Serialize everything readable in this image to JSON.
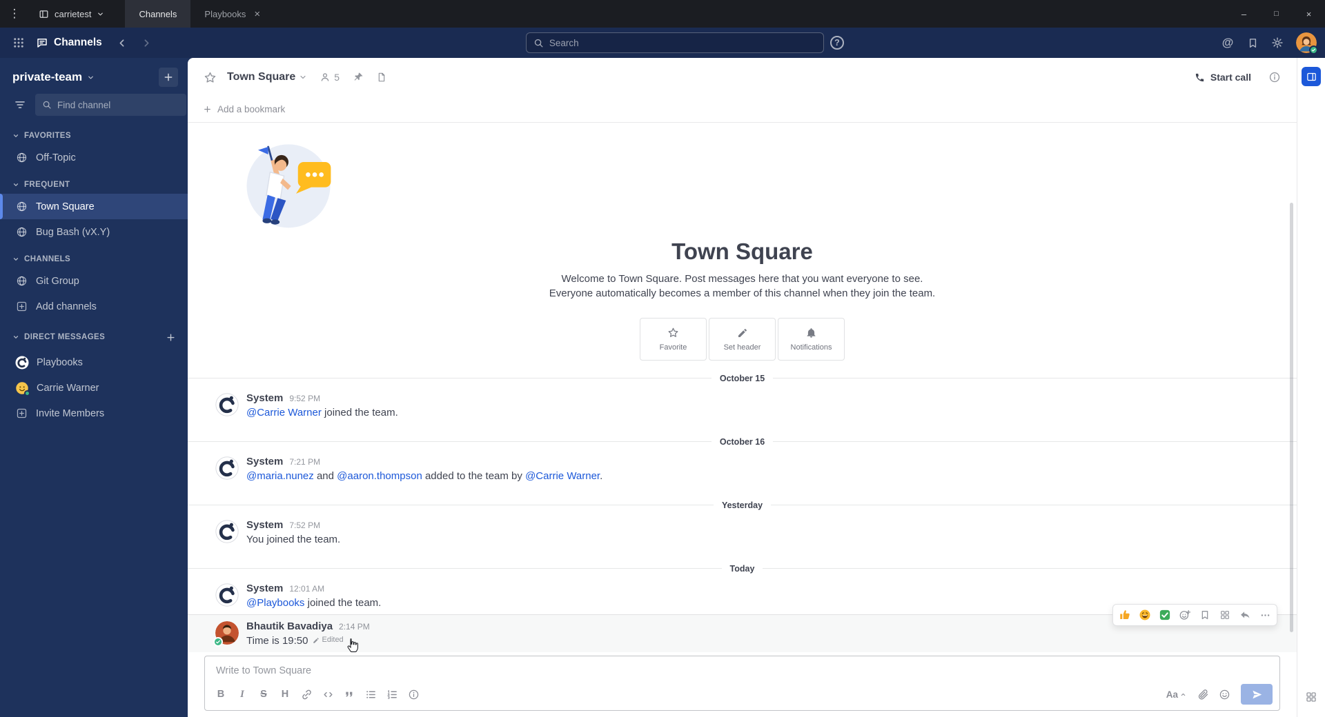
{
  "glyphs": {
    "menu": "⋮",
    "close": "×",
    "at": "@",
    "help": "?"
  },
  "window_bar": {
    "server_name": "carrietest",
    "tabs": [
      {
        "label": "Channels"
      },
      {
        "label": "Playbooks"
      }
    ],
    "controls": {
      "minimize": "–",
      "maximize": "□",
      "close": "×"
    }
  },
  "global_header": {
    "product_name": "Channels",
    "search_placeholder": "Search"
  },
  "sidebar": {
    "team_name": "private-team",
    "find_channel_placeholder": "Find channel",
    "sections": {
      "favorites": "FAVORITES",
      "frequent": "FREQUENT",
      "channels": "CHANNELS",
      "direct_messages": "DIRECT MESSAGES"
    },
    "items": {
      "off_topic": "Off-Topic",
      "town_square": "Town Square",
      "bug_bash": "Bug Bash (vX.Y)",
      "git_group": "Git Group",
      "add_channels": "Add channels",
      "playbooks": "Playbooks",
      "carrie_warner": "Carrie Warner",
      "invite_members": "Invite Members"
    }
  },
  "channel_header": {
    "name": "Town Square",
    "member_count": "5",
    "start_call": "Start call",
    "add_bookmark": "Add a bookmark"
  },
  "intro": {
    "title": "Town Square",
    "description": "Welcome to Town Square. Post messages here that you want everyone to see. Everyone automatically becomes a member of this channel when they join the team.",
    "actions": {
      "favorite": "Favorite",
      "set_header": "Set header",
      "notifications": "Notifications"
    }
  },
  "timeline": {
    "dividers": {
      "d1": "October 15",
      "d2": "October 16",
      "d3": "Yesterday",
      "d4": "Today"
    },
    "messages": {
      "m1": {
        "user": "System",
        "time": "9:52 PM",
        "mention1": "@Carrie Warner",
        "text1": " joined the team."
      },
      "m2": {
        "user": "System",
        "time": "7:21 PM",
        "mention1": "@maria.nunez",
        "text1": " and ",
        "mention2": "@aaron.thompson",
        "text2": " added to the team by ",
        "mention3": "@Carrie Warner",
        "text3": "."
      },
      "m3": {
        "user": "System",
        "time": "7:52 PM",
        "text1": "You joined the team."
      },
      "m4": {
        "user": "System",
        "time": "12:01 AM",
        "mention1": "@Playbooks",
        "text1": " joined the team."
      },
      "m5": {
        "user": "Bhautik Bavadiya",
        "time": "2:14 PM",
        "text1": "Time is 19:50",
        "edited": "Edited"
      }
    }
  },
  "composer": {
    "placeholder": "Write to Town Square",
    "buttons": {
      "bold": "B",
      "italic": "I",
      "strike": "S",
      "heading": "H",
      "format_toggle": "Aa"
    }
  },
  "colors": {
    "accent": "#1c58d9",
    "sidebar_bg": "#1e325c",
    "header_bg": "#1a2b52",
    "window_bar_bg": "#1b1d22",
    "online_green": "#3db887",
    "mention_link": "#1c58d9"
  }
}
